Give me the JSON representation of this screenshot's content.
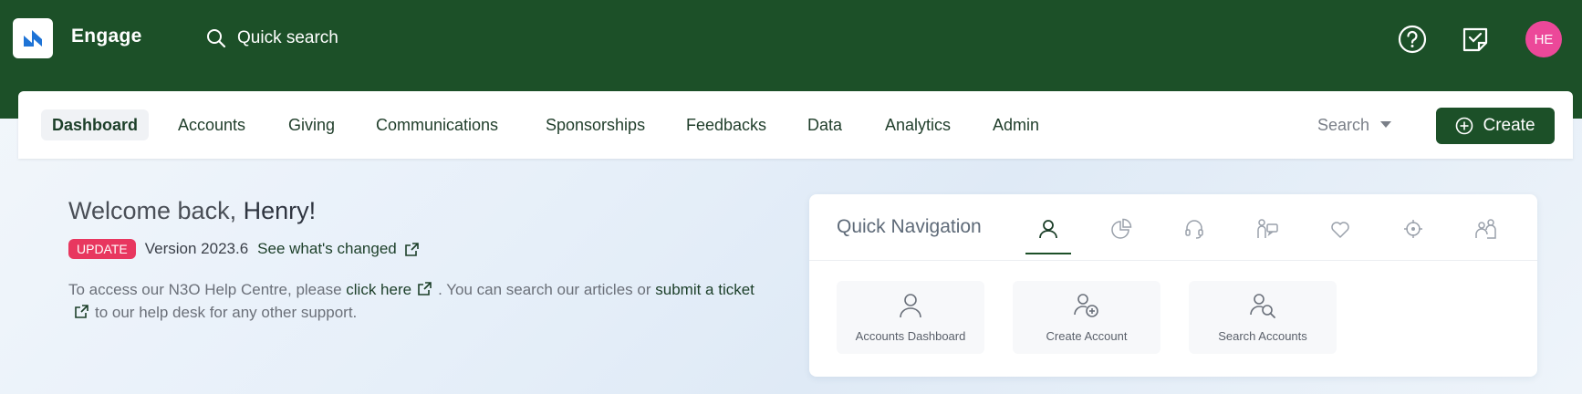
{
  "app": {
    "name": "Engage"
  },
  "header": {
    "search_label": "Quick search",
    "avatar_initials": "HE"
  },
  "nav": {
    "items": [
      {
        "label": "Dashboard",
        "active": true
      },
      {
        "label": "Accounts"
      },
      {
        "label": "Giving"
      },
      {
        "label": "Communications"
      },
      {
        "label": "Sponsorships"
      },
      {
        "label": "Feedbacks"
      },
      {
        "label": "Data"
      },
      {
        "label": "Analytics"
      },
      {
        "label": "Admin"
      }
    ],
    "search_label": "Search",
    "create_label": "Create"
  },
  "welcome": {
    "greeting": "Welcome back,",
    "name": "Henry!",
    "badge": "UPDATE",
    "version": "Version 2023.6",
    "changes_link": "See what's changed",
    "help_part1": "To access our N3O Help Centre, please",
    "help_link1": "click here",
    "help_part2": ". You can search our articles or",
    "help_link2": "submit a ticket",
    "help_part3": "to our help desk for any other support."
  },
  "quick_nav": {
    "title": "Quick Navigation",
    "tabs": [
      "user-icon",
      "pie-chart-icon",
      "headset-icon",
      "person-chat-icon",
      "heart-icon",
      "target-icon",
      "people-icon"
    ],
    "tiles": [
      {
        "label": "Accounts Dashboard",
        "icon": "user-icon"
      },
      {
        "label": "Create Account",
        "icon": "user-add-icon"
      },
      {
        "label": "Search Accounts",
        "icon": "user-search-icon"
      }
    ]
  },
  "colors": {
    "brand": "#1c5028",
    "badge": "#e8375f",
    "avatar": "#ec4899"
  }
}
